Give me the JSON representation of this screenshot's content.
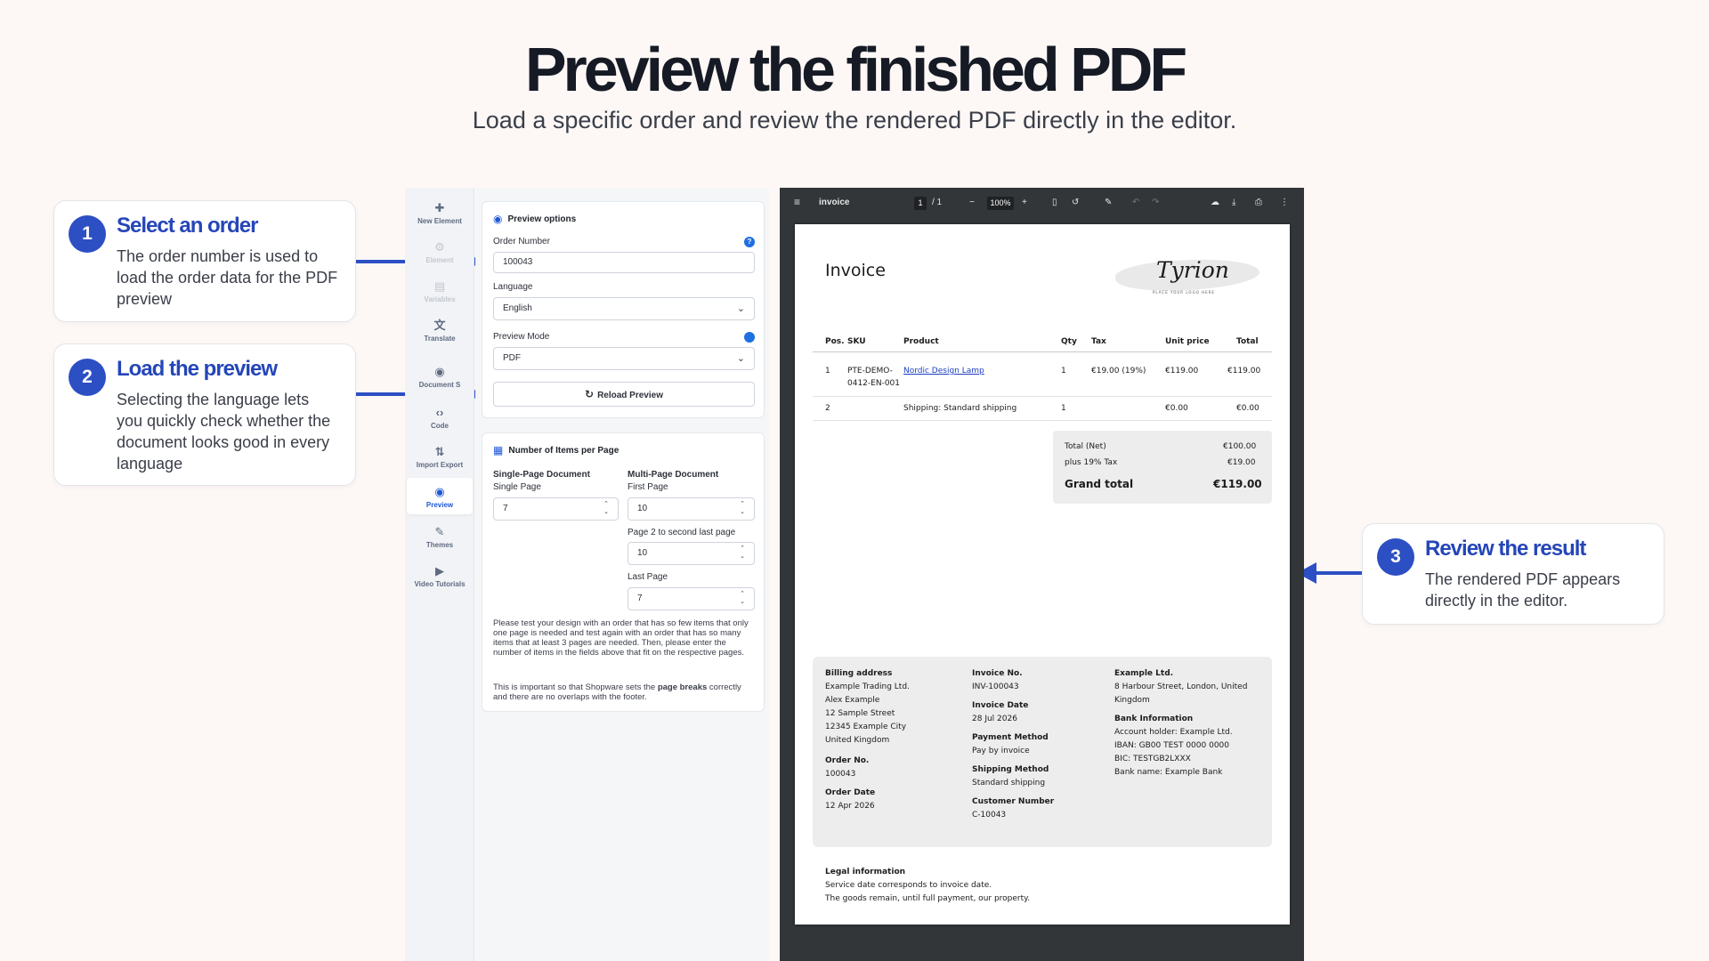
{
  "hero": {
    "title": "Preview the finished PDF",
    "subtitle": "Load a specific order and review the rendered PDF directly in the editor."
  },
  "callouts": [
    {
      "num": "1",
      "title": "Select an order",
      "text": "The order number is used to load the order data for the PDF preview"
    },
    {
      "num": "2",
      "title": "Load the preview",
      "text": "Selecting the language lets you quickly check whether the document looks good in every language"
    },
    {
      "num": "3",
      "title": "Review the result",
      "text": "The rendered PDF appears directly in the editor."
    }
  ],
  "colors": {
    "accent": "#2d4fc4",
    "link": "#1f58d6",
    "viewer_bg": "#323639"
  },
  "rail": {
    "items": [
      {
        "label": "New Element",
        "icon": "puzzle-icon",
        "state": "normal"
      },
      {
        "label": "Element",
        "icon": "gear-icon",
        "state": "dim"
      },
      {
        "label": "Variables",
        "icon": "braces-icon",
        "state": "dim"
      },
      {
        "label": "Translate",
        "icon": "translate-icon",
        "state": "normal"
      },
      {
        "label": "Document S",
        "icon": "palette-icon",
        "state": "normal"
      },
      {
        "label": "Code",
        "icon": "code-icon",
        "state": "normal"
      },
      {
        "label": "Import Export",
        "icon": "import-export-icon",
        "state": "normal"
      },
      {
        "label": "Preview",
        "icon": "eye-icon",
        "state": "active"
      },
      {
        "label": "Themes",
        "icon": "brush-icon",
        "state": "normal"
      },
      {
        "label": "Video Tutorials",
        "icon": "video-icon",
        "state": "normal"
      }
    ]
  },
  "preview_options": {
    "heading": "Preview options",
    "order_number_label": "Order Number",
    "order_number_value": "100043",
    "language_label": "Language",
    "language_value": "English",
    "mode_label": "Preview Mode",
    "mode_value": "PDF",
    "reload_label": "Reload Preview"
  },
  "items_per_page": {
    "heading": "Number of Items per Page",
    "single_heading": "Single-Page Document",
    "single_label": "Single Page",
    "single_value": "7",
    "multi_heading": "Multi-Page Document",
    "first_label": "First Page",
    "first_value": "10",
    "middle_label": "Page 2 to second last page",
    "middle_value": "10",
    "last_label": "Last Page",
    "last_value": "7",
    "note_1": "Please test your design with an order that has so few items that only one page is needed and test again with an order that has so many items that at least 3 pages are needed. Then, please enter the number of items in the fields above that fit on the respective pages.",
    "note_2_pre": "This is important so that Shopware sets the ",
    "note_2_bold": "page breaks",
    "note_2_post": " correctly and there are no overlaps with the footer."
  },
  "viewer": {
    "filename": "invoice",
    "page_current": "1",
    "page_total": "/ 1",
    "zoom": "100%"
  },
  "invoice": {
    "title": "Invoice",
    "logo_text": "Tyrion",
    "logo_tagline": "PLACE YOUR LOGO HERE",
    "headers": {
      "pos": "Pos.",
      "sku": "SKU",
      "product": "Product",
      "qty": "Qty",
      "tax": "Tax",
      "unit": "Unit price",
      "total": "Total"
    },
    "rows": [
      {
        "pos": "1",
        "sku_1": "PTE-DEMO-",
        "sku_2": "0412-EN-001",
        "product": "Nordic Design Lamp",
        "qty": "1",
        "tax": "€19.00 (19%)",
        "unit": "€119.00",
        "total": "€119.00"
      },
      {
        "pos": "2",
        "sku_1": "",
        "sku_2": "",
        "product": "Shipping: Standard shipping",
        "qty": "1",
        "tax": "",
        "unit": "€0.00",
        "total": "€0.00"
      }
    ],
    "totals": {
      "net_label": "Total (Net)",
      "net_value": "€100.00",
      "tax_label": "plus 19% Tax",
      "tax_value": "€19.00",
      "grand_label": "Grand total",
      "grand_value": "€119.00"
    },
    "billing": {
      "label": "Billing address",
      "lines": [
        "Example Trading Ltd.",
        "Alex Example",
        "12 Sample Street",
        "12345 Example City",
        "United Kingdom"
      ],
      "order_no_label": "Order No.",
      "order_no": "100043",
      "order_date_label": "Order Date",
      "order_date": "12 Apr 2026"
    },
    "meta": {
      "invoice_no_label": "Invoice No.",
      "invoice_no": "INV-100043",
      "invoice_date_label": "Invoice Date",
      "invoice_date": "28 Jul 2026",
      "payment_label": "Payment Method",
      "payment": "Pay by invoice",
      "shipping_label": "Shipping Method",
      "shipping": "Standard shipping",
      "customer_label": "Customer Number",
      "customer": "C-10043"
    },
    "company": {
      "name": "Example Ltd.",
      "address_1": "8 Harbour Street, London, United",
      "address_2": "Kingdom",
      "bank_label": "Bank Information",
      "bank_lines": [
        "Account holder: Example Ltd.",
        "IBAN: GB00 TEST 0000 0000",
        "BIC: TESTGB2LXXX",
        "Bank name: Example Bank"
      ]
    },
    "legal": {
      "label": "Legal information",
      "line_1": "Service date corresponds to invoice date.",
      "line_2": "The goods remain, until full payment, our property."
    }
  }
}
